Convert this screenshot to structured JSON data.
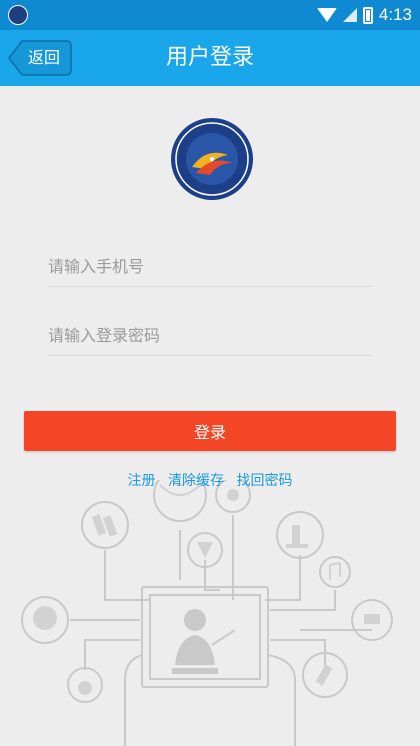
{
  "status_bar": {
    "time": "4:13"
  },
  "header": {
    "back_label": "返回",
    "title": "用户登录"
  },
  "form": {
    "phone_placeholder": "请输入手机号",
    "password_placeholder": "请输入登录密码",
    "login_label": "登录"
  },
  "links": {
    "register": "注册",
    "clear_cache": "清除缓存",
    "recover_password": "找回密码"
  },
  "colors": {
    "header": "#1aa6ea",
    "status_bar": "#0f8ad2",
    "login_button": "#f44627",
    "link": "#1a9ae0",
    "background": "#ededed"
  },
  "icons": [
    "app-logo-icon",
    "wifi-icon",
    "signal-icon",
    "battery-icon",
    "school-logo-icon",
    "education-illustration"
  ]
}
